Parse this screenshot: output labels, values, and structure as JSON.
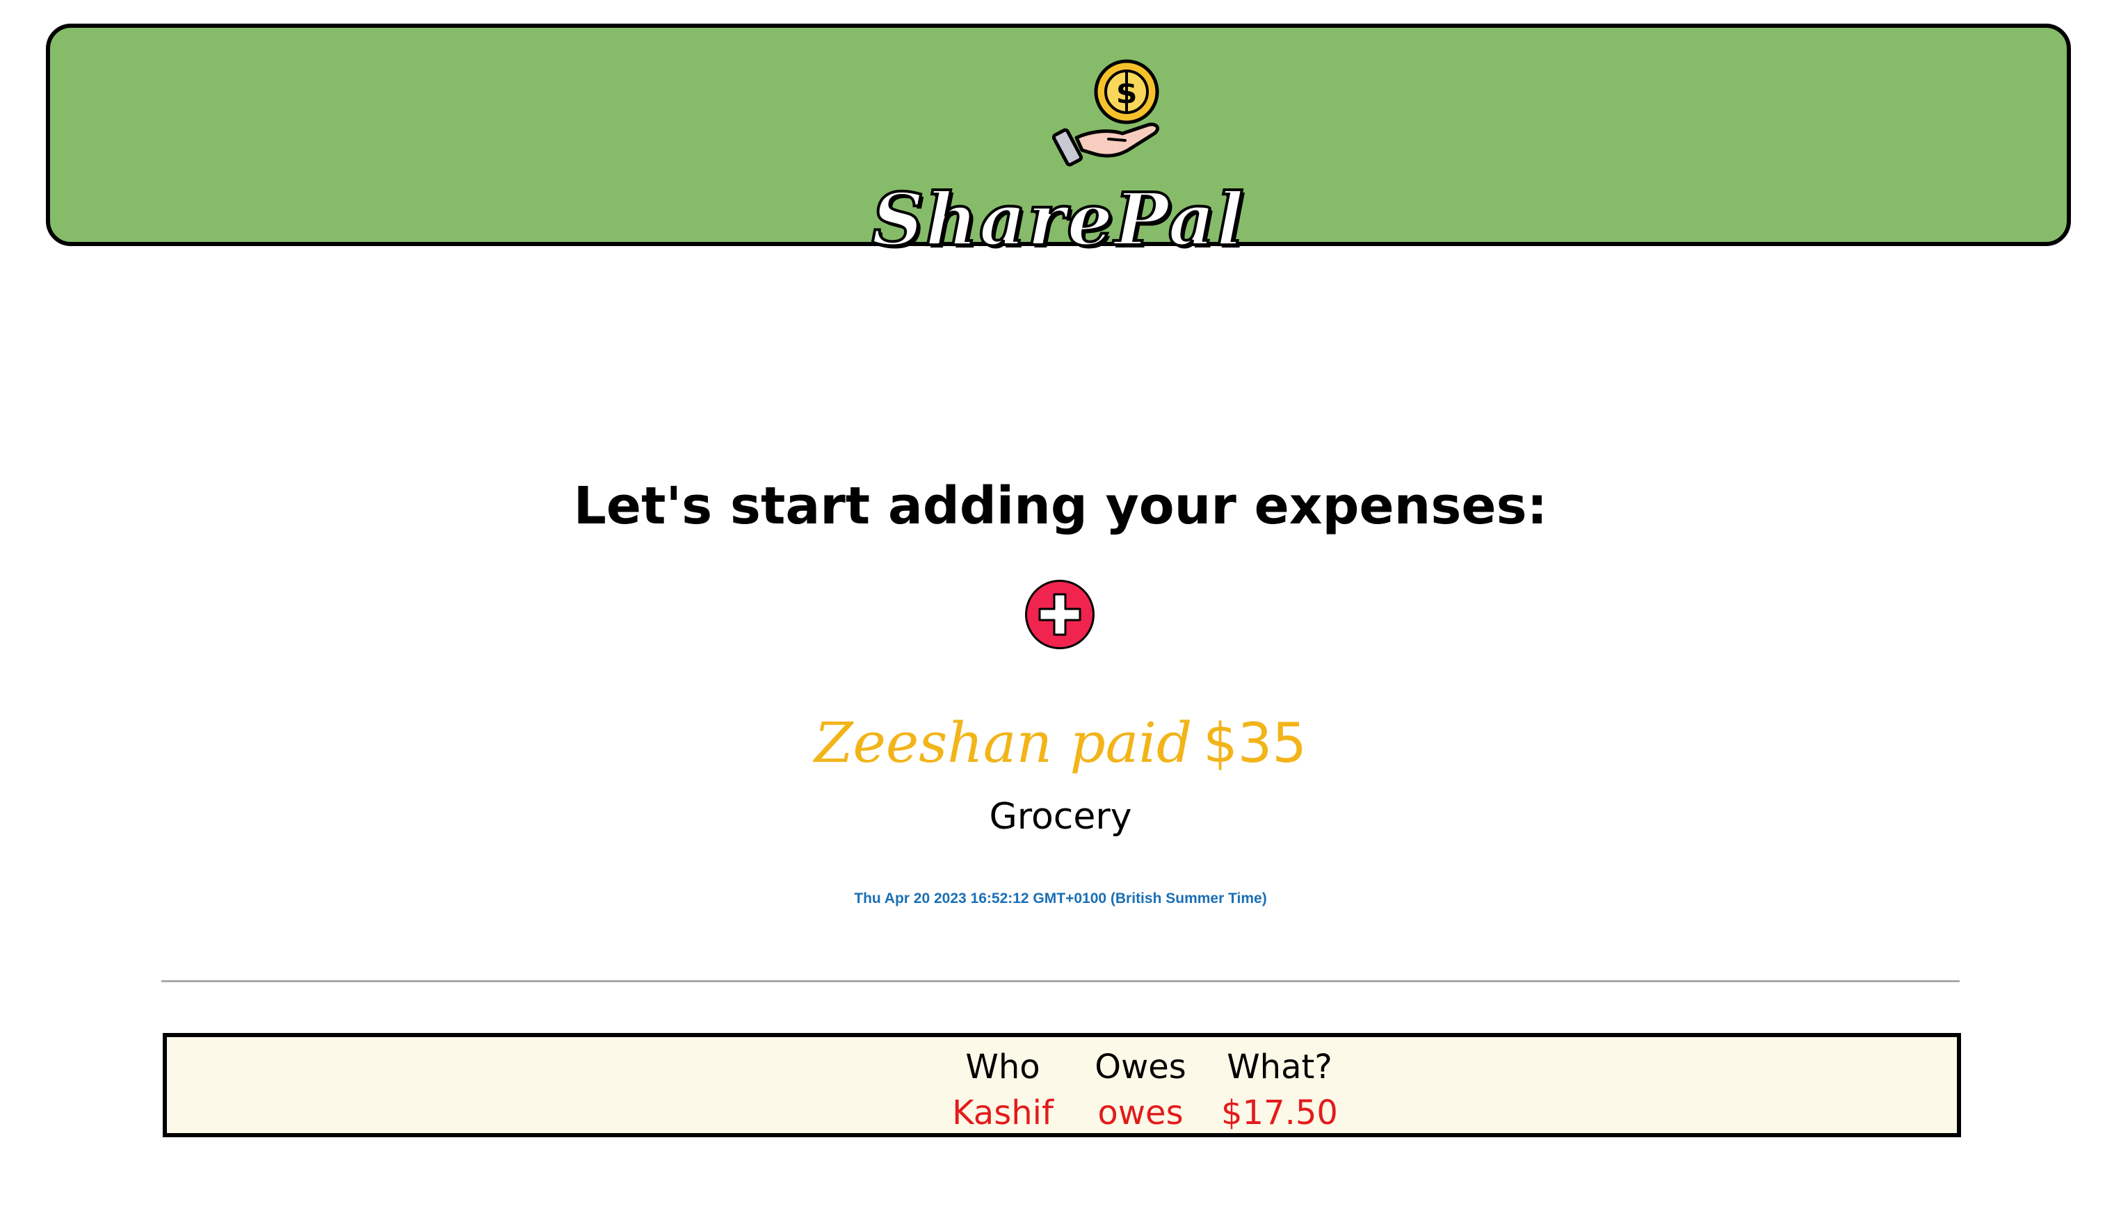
{
  "header": {
    "brand": "SharePal",
    "logo_icon": "hand-coin-icon",
    "background_color": "#86bc69"
  },
  "main": {
    "heading": "Let's start adding your expenses:",
    "add_button_icon": "plus-icon",
    "add_button_color": "#f0244f",
    "expense": {
      "payer_text": "Zeeshan paid",
      "amount": "$35",
      "category": "Grocery",
      "timestamp": "Thu Apr 20 2023 16:52:12 GMT+0100 (British Summer Time)"
    }
  },
  "summary": {
    "headers": [
      "Who",
      "Owes",
      "What?"
    ],
    "rows": [
      [
        "Kashif",
        "owes",
        "$17.50"
      ]
    ],
    "value_color": "#e31b1b",
    "background_color": "#fdf9e8"
  }
}
